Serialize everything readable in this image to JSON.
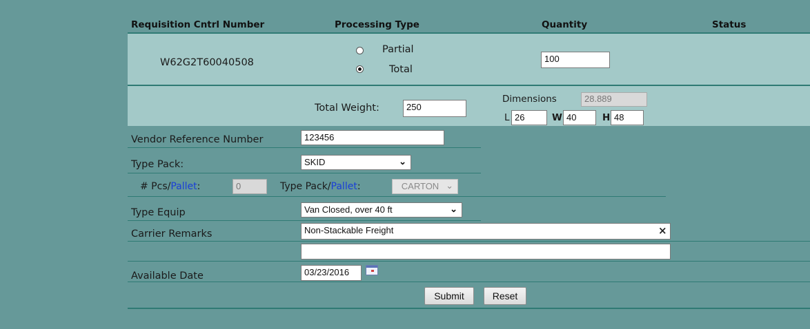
{
  "table_headers": {
    "req": "Requisition Cntrl Number",
    "ptype": "Processing Type",
    "qty": "Quantity",
    "status": "Status"
  },
  "row": {
    "req_number": "W62G2T60040508",
    "option_partial": "Partial",
    "option_total": "Total",
    "selected_option": "Total",
    "quantity": "100",
    "status": ""
  },
  "weight": {
    "label": "Total Weight:",
    "value": "250"
  },
  "dimensions": {
    "label": "Dimensions",
    "total": "28.889",
    "l_label": "L",
    "l_value": "26",
    "w_label": "W",
    "w_value": "40",
    "h_label": "H",
    "h_value": "48"
  },
  "form": {
    "vendor_ref_label": "Vendor Reference Number",
    "vendor_ref_value": "123456",
    "type_pack_label": "Type Pack:",
    "type_pack_value": "SKID",
    "pcs_prefix": "# Pcs/",
    "pcs_link": "Pallet",
    "pcs_suffix": ":",
    "pcs_value": "0",
    "tp_pallet_prefix": "Type Pack/",
    "tp_pallet_link": "Pallet",
    "tp_pallet_suffix": ":",
    "tp_pallet_value": "CARTON",
    "type_equip_label": "Type Equip",
    "type_equip_value": "Van Closed, over 40 ft",
    "carrier_remarks_label": "Carrier Remarks",
    "carrier_remarks_value": "Non-Stackable Freight",
    "carrier_remarks_2": "",
    "clear_glyph": "×",
    "available_date_label": "Available Date",
    "available_date_value": "03/23/2016"
  },
  "buttons": {
    "submit": "Submit",
    "reset": "Reset"
  },
  "icons": {
    "calendar": "calendar-icon",
    "dropdown": "chevron-down-icon",
    "clear": "close-icon",
    "chevron_glyph": "❯"
  },
  "colors": {
    "page_bg": "#669999",
    "band_bg": "#a3c9c8",
    "link_blue": "#1b3fd6"
  }
}
